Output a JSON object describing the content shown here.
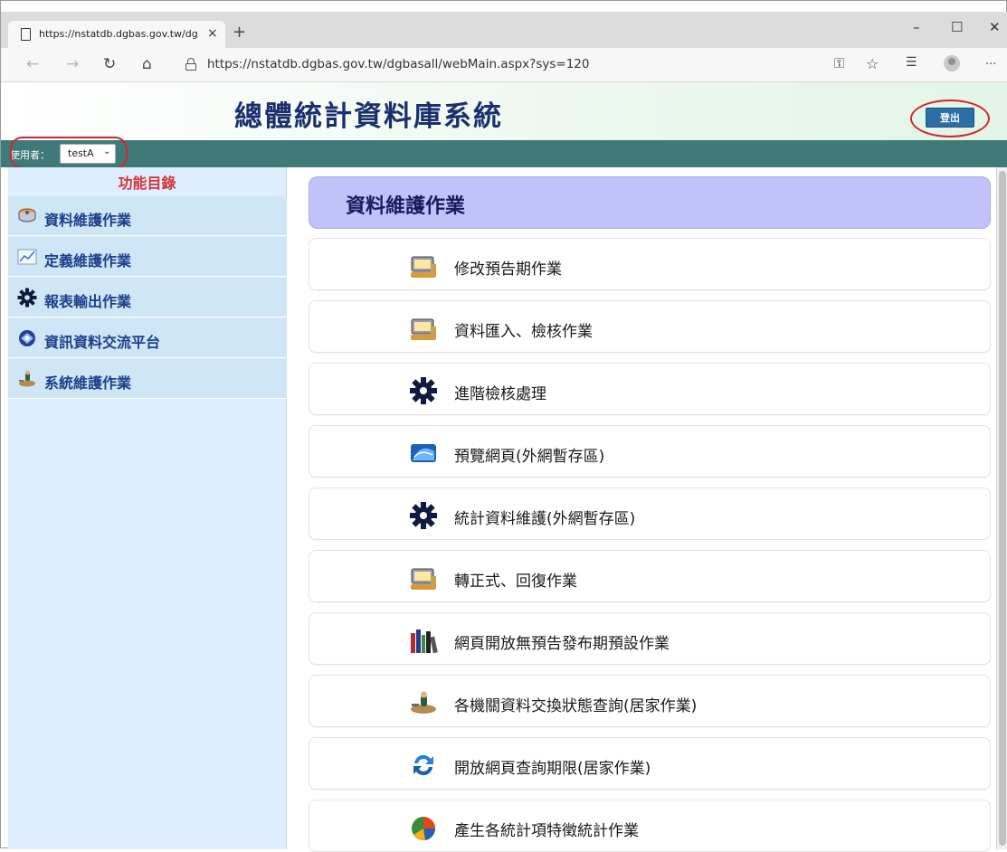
{
  "browser": {
    "tab_title": "https://nstatdb.dgbas.gov.tw/dg",
    "tab_close": "×",
    "new_tab": "+",
    "url": "https://nstatdb.dgbas.gov.tw/dgbasall/webMain.aspx?sys=120",
    "window_controls": {
      "minimize": "–",
      "maximize": "☐",
      "close": "✕"
    },
    "nav": {
      "back": "←",
      "forward": "→",
      "refresh": "↻",
      "home": "⌂",
      "key": "⚿",
      "favorite": "☆",
      "favorites": "☰",
      "more": "···"
    }
  },
  "header": {
    "title": "總體統計資料庫系統",
    "logout_label": "登出"
  },
  "userbar": {
    "user_label": "使用者：",
    "user_value": "testA",
    "caret": "⌄"
  },
  "sidebar": {
    "heading": "功能目錄",
    "items": [
      {
        "label": "資料維護作業",
        "icon": "database-icon"
      },
      {
        "label": "定義維護作業",
        "icon": "line-chart-icon"
      },
      {
        "label": "報表輸出作業",
        "icon": "gear-icon"
      },
      {
        "label": "資訊資料交流平台",
        "icon": "exchange-icon"
      },
      {
        "label": "系統維護作業",
        "icon": "tools-icon"
      }
    ]
  },
  "main": {
    "section_title": "資料維護作業",
    "items": [
      {
        "label": "修改預告期作業",
        "icon": "computer-icon"
      },
      {
        "label": "資料匯入、檢核作業",
        "icon": "computer-icon"
      },
      {
        "label": "進階檢核處理",
        "icon": "gear-icon"
      },
      {
        "label": "預覽網頁(外網暫存區)",
        "icon": "preview-icon"
      },
      {
        "label": "統計資料維護(外網暫存區)",
        "icon": "gear-icon"
      },
      {
        "label": "轉正式、回復作業",
        "icon": "computer-icon"
      },
      {
        "label": "網頁開放無預告發布期預設作業",
        "icon": "books-icon"
      },
      {
        "label": "各機關資料交換狀態查詢(居家作業)",
        "icon": "exchange-icon"
      },
      {
        "label": "開放網頁查詢期限(居家作業)",
        "icon": "refresh-icon"
      },
      {
        "label": "產生各統計項特徵統計作業",
        "icon": "pie-chart-icon"
      }
    ]
  },
  "colors": {
    "userbar": "#3f7a78",
    "sidebar": "#dceeff",
    "section_header": "#c2c2fa",
    "logout_button": "#2c6ea6",
    "annotation": "#d2262c"
  }
}
